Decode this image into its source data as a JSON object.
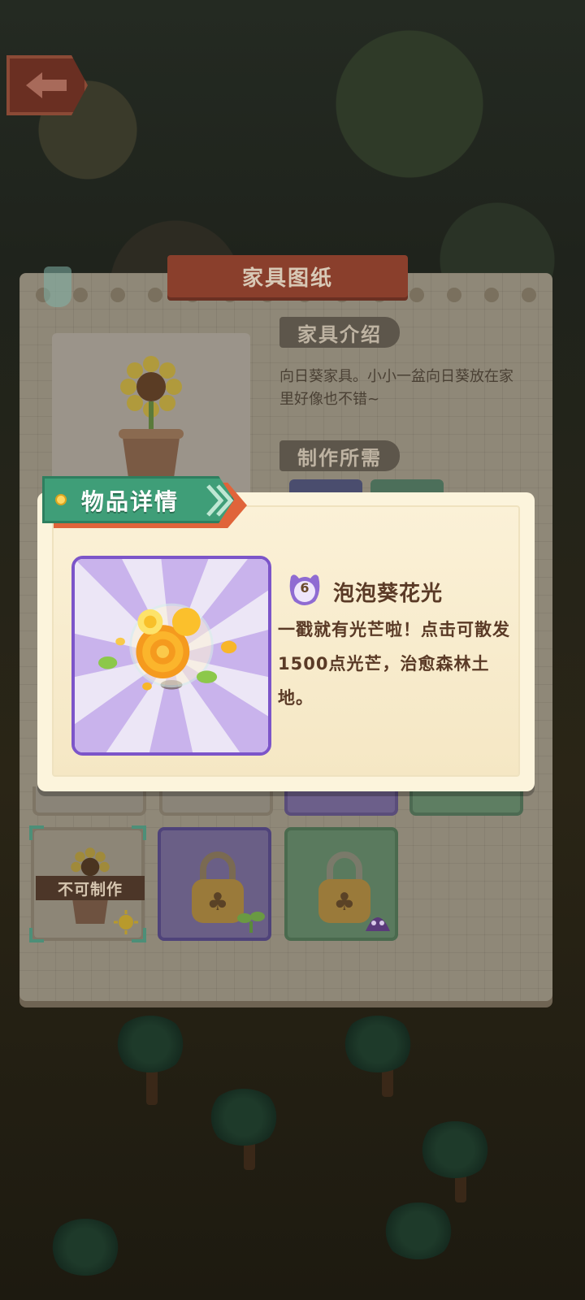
{
  "header": {
    "back_icon": "back-arrow-icon"
  },
  "blueprint_panel": {
    "title": "家具图纸",
    "intro_label": "家具介绍",
    "intro_text": "向日葵家具。小小一盆向日葵放在家里好像也不错~",
    "requirements_label": "制作所需",
    "preview_icon": "sunflower-pot-icon",
    "grid_items": [
      {
        "state": "cannot-craft",
        "label": "不可制作",
        "icon": "sunflower-pot-icon",
        "badge_icon": "sun-badge-icon"
      },
      {
        "state": "locked",
        "icon": "lock-icon",
        "badge_icon": "sprout-icon"
      },
      {
        "state": "locked",
        "icon": "lock-icon",
        "badge_icon": "purple-monster-icon"
      }
    ]
  },
  "item_detail": {
    "title": "物品详情",
    "level": "6",
    "name": "泡泡葵花光",
    "description": "一戳就有光芒啦！点击可散发1500点光芒，治愈森林土地。",
    "image_icon": "bubble-flower-light-icon"
  },
  "colors": {
    "ribbon_green": "#3f9e78",
    "ribbon_red": "#e0643a",
    "popup_bg": "#fcf4dc",
    "item_frame": "#7c55c9",
    "text_brown": "#5a3a26"
  }
}
